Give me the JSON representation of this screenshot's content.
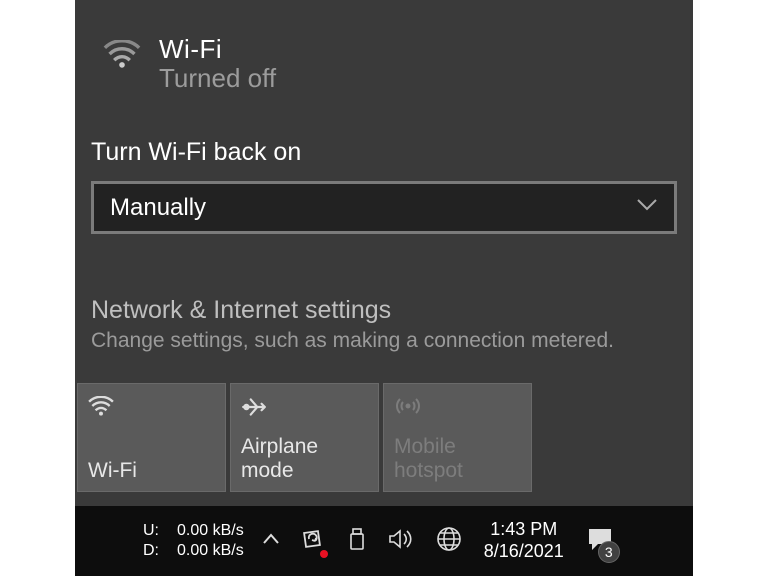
{
  "wifi": {
    "title": "Wi-Fi",
    "status": "Turned off",
    "turn_on_label": "Turn Wi-Fi back on",
    "selector_value": "Manually"
  },
  "settings_link": {
    "title": "Network & Internet settings",
    "subtitle": "Change settings, such as making a connection metered."
  },
  "tiles": {
    "wifi": "Wi-Fi",
    "airplane": "Airplane mode",
    "hotspot": "Mobile hotspot"
  },
  "taskbar": {
    "up_label": "U:",
    "up_value": "0.00 kB/s",
    "down_label": "D:",
    "down_value": "0.00 kB/s",
    "time": "1:43 PM",
    "date": "8/16/2021",
    "notification_count": "3"
  }
}
